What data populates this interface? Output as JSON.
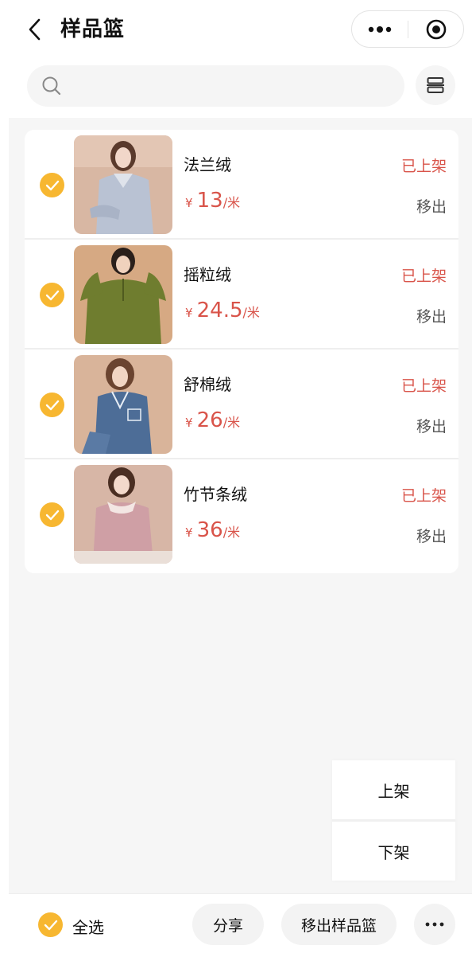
{
  "header": {
    "title": "样品篮",
    "back_icon": "chevron-left-icon",
    "capsule": {
      "more_icon": "more-dots-icon",
      "target_icon": "target-icon"
    }
  },
  "search": {
    "icon": "search-icon",
    "placeholder": "",
    "value": "",
    "layout_icon": "layout-toggle-icon"
  },
  "items": [
    {
      "name": "法兰绒",
      "currency": "¥",
      "price": "13",
      "unit": "/米",
      "status": "已上架",
      "action": "移出",
      "checked": true,
      "image": "pajama-gray-photo"
    },
    {
      "name": "摇粒绒",
      "currency": "¥",
      "price": "24.5",
      "unit": "/米",
      "status": "已上架",
      "action": "移出",
      "checked": true,
      "image": "pullover-green-photo"
    },
    {
      "name": "舒棉绒",
      "currency": "¥",
      "price": "26",
      "unit": "/米",
      "status": "已上架",
      "action": "移出",
      "checked": true,
      "image": "pajama-blue-photo"
    },
    {
      "name": "竹节条绒",
      "currency": "¥",
      "price": "36",
      "unit": "/米",
      "status": "已上架",
      "action": "移出",
      "checked": true,
      "image": "pajama-pink-photo"
    }
  ],
  "popup_menu": {
    "on_shelf": "上架",
    "off_shelf": "下架"
  },
  "bottom_bar": {
    "select_all": "全选",
    "select_all_checked": true,
    "share": "分享",
    "remove_from_basket": "移出样品篮",
    "more_icon": "more-dots-icon"
  },
  "colors": {
    "accent_check": "#f7b731",
    "price_red": "#d9544a",
    "background": "#f6f6f6"
  }
}
